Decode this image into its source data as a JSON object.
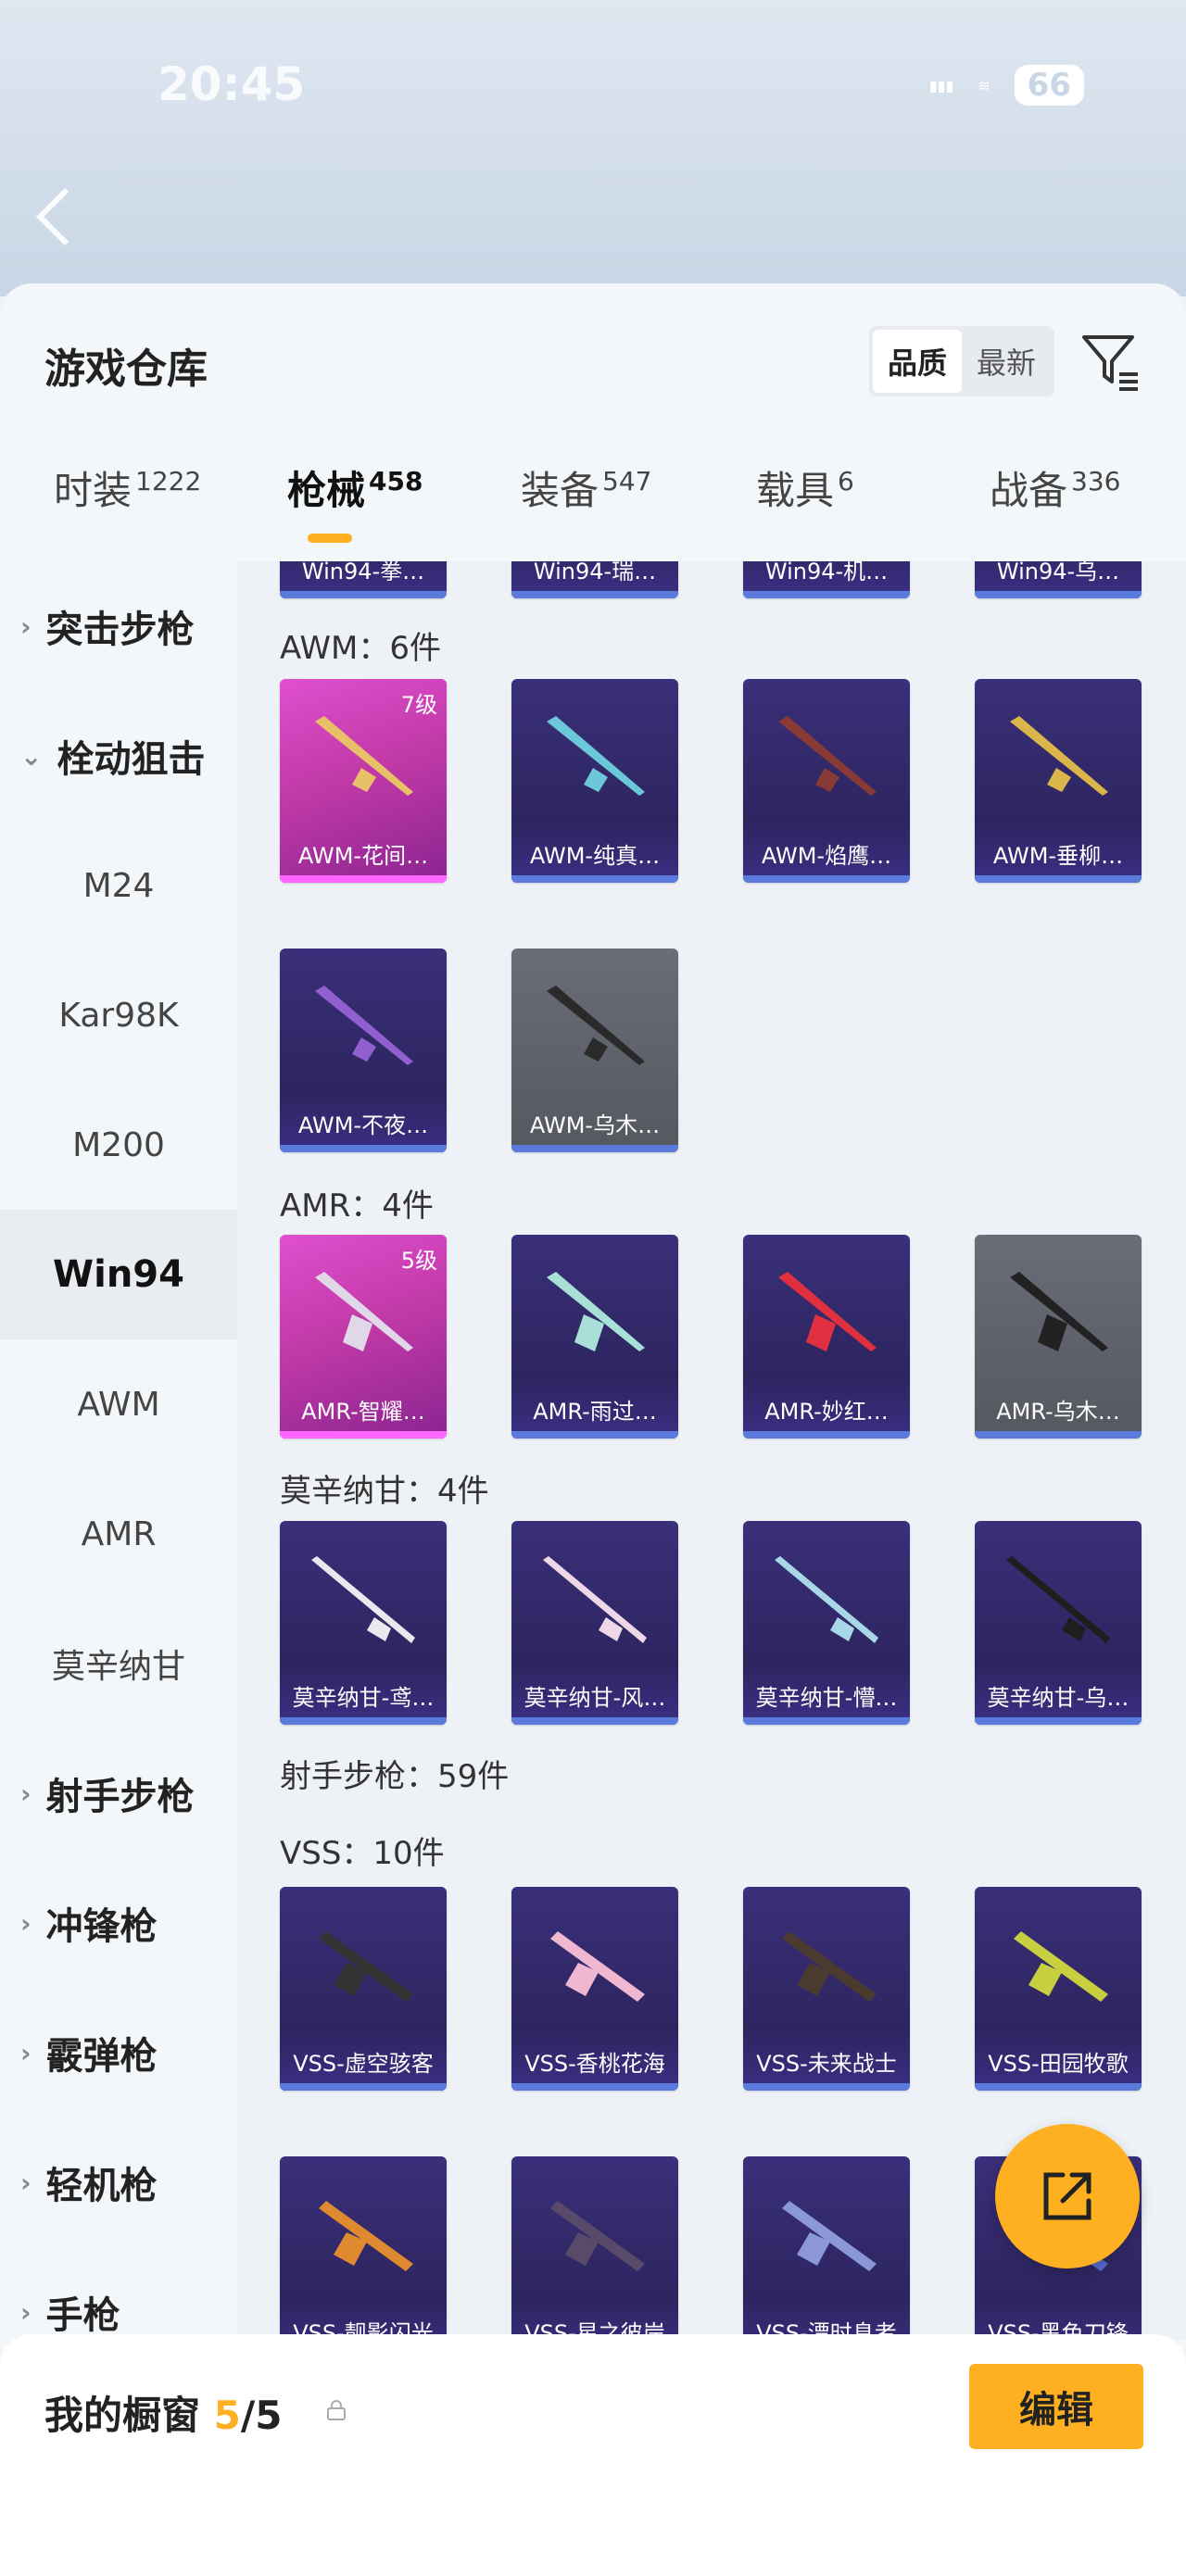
{
  "status": {
    "time": "20:45",
    "battery": "66"
  },
  "header": {
    "title": "游戏仓库",
    "sort_options": [
      "品质",
      "最新"
    ],
    "active_sort": "品质"
  },
  "tabs": [
    {
      "label": "时装",
      "count": "1222"
    },
    {
      "label": "枪械",
      "count": "458"
    },
    {
      "label": "装备",
      "count": "547"
    },
    {
      "label": "载具",
      "count": "6"
    },
    {
      "label": "战备",
      "count": "336"
    }
  ],
  "sidebar": [
    {
      "label": "突击步枪",
      "type": "category",
      "arrow": "›"
    },
    {
      "label": "栓动狙击",
      "type": "category",
      "arrow": "⌄"
    },
    {
      "label": "M24"
    },
    {
      "label": "Kar98K"
    },
    {
      "label": "M200"
    },
    {
      "label": "Win94",
      "selected": true
    },
    {
      "label": "AWM"
    },
    {
      "label": "AMR"
    },
    {
      "label": "莫辛纳甘"
    },
    {
      "label": "射手步枪",
      "type": "category",
      "arrow": "›"
    },
    {
      "label": "冲锋枪",
      "type": "category",
      "arrow": "›"
    },
    {
      "label": "霰弹枪",
      "type": "category",
      "arrow": "›"
    },
    {
      "label": "轻机枪",
      "type": "category",
      "arrow": "›"
    },
    {
      "label": "手枪",
      "type": "category",
      "arrow": "›"
    }
  ],
  "win94_partial": [
    "Win94-拳…",
    "Win94-瑞…",
    "Win94-机…",
    "Win94-乌…"
  ],
  "sections": {
    "awm": {
      "label": "AWM：6件"
    },
    "amr": {
      "label": "AMR：4件"
    },
    "mosin": {
      "label": "莫辛纳甘：4件"
    },
    "dmr": {
      "label": "射手步枪：59件"
    },
    "vss": {
      "label": "VSS：10件"
    }
  },
  "items": {
    "awm": [
      {
        "name": "AWM-花间…",
        "level": "7级",
        "quality": "pink"
      },
      {
        "name": "AWM-纯真…",
        "quality": "purple"
      },
      {
        "name": "AWM-焰鹰…",
        "quality": "purple"
      },
      {
        "name": "AWM-垂柳…",
        "quality": "purple"
      },
      {
        "name": "AWM-不夜…",
        "quality": "purple"
      },
      {
        "name": "AWM-乌木…",
        "quality": "grey"
      }
    ],
    "amr": [
      {
        "name": "AMR-智耀…",
        "level": "5级",
        "quality": "pink"
      },
      {
        "name": "AMR-雨过…",
        "quality": "purple"
      },
      {
        "name": "AMR-妙红…",
        "quality": "purple"
      },
      {
        "name": "AMR-乌木…",
        "quality": "grey"
      }
    ],
    "mosin": [
      {
        "name": "莫辛纳甘-鸢…",
        "quality": "purple"
      },
      {
        "name": "莫辛纳甘-风…",
        "quality": "purple"
      },
      {
        "name": "莫辛纳甘-懵…",
        "quality": "purple"
      },
      {
        "name": "莫辛纳甘-乌…",
        "quality": "purple"
      }
    ],
    "vss": [
      {
        "name": "VSS-虚空骇客",
        "quality": "purple"
      },
      {
        "name": "VSS-香桃花海",
        "quality": "purple"
      },
      {
        "name": "VSS-未来战士",
        "quality": "purple"
      },
      {
        "name": "VSS-田园牧歌",
        "quality": "purple"
      },
      {
        "name": "VSS-靓影闪光",
        "quality": "purple"
      },
      {
        "name": "VSS-星之彼岸",
        "quality": "purple"
      },
      {
        "name": "VSS-漂时息者",
        "quality": "purple"
      },
      {
        "name": "VSS-黑色刀锋",
        "quality": "purple"
      }
    ]
  },
  "showcase": {
    "title": "我的橱窗",
    "count": "5",
    "total": "/5",
    "edit_label": "编辑"
  },
  "colors": {
    "accent": "#ffb020",
    "purple_card": "#3a2f7a",
    "pink_card": "#e04fd0",
    "grey_card": "#5f626b"
  }
}
